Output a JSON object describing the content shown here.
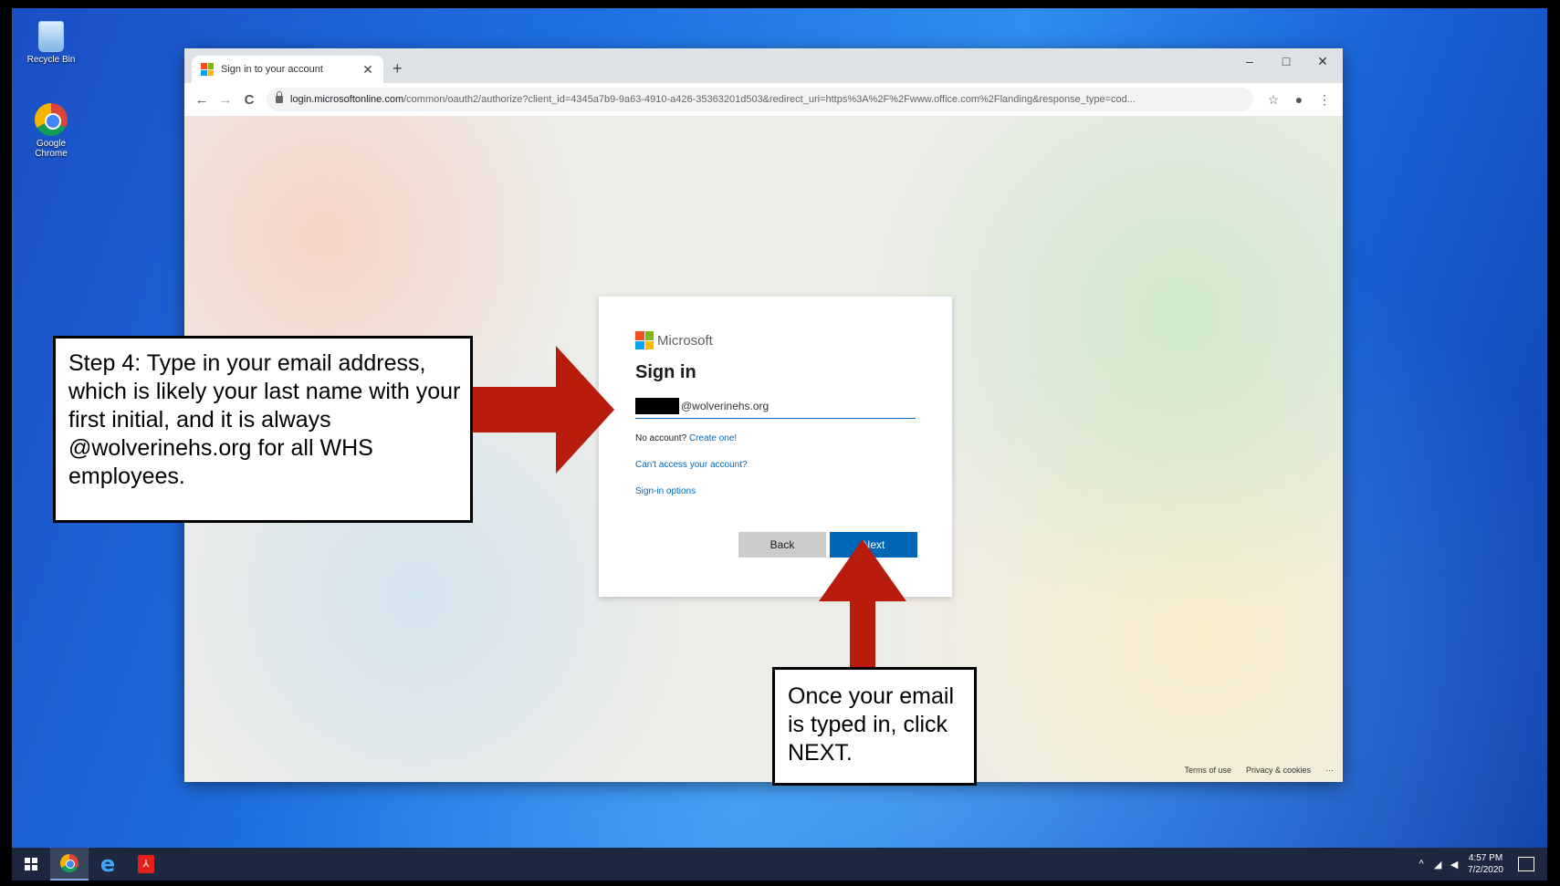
{
  "desktop": {
    "icons": [
      {
        "label": "Recycle Bin"
      },
      {
        "label": "Google Chrome"
      }
    ]
  },
  "browser": {
    "tab_title": "Sign in to your account",
    "new_tab_label": "+",
    "window_controls": {
      "minimize": "–",
      "maximize": "□",
      "close": "✕"
    },
    "nav": {
      "back": "←",
      "forward": "→",
      "reload": "C"
    },
    "url_host": "login.microsoftonline.com",
    "url_rest": "/common/oauth2/authorize?client_id=4345a7b9-9a63-4910-a426-35363201d503&redirect_uri=https%3A%2F%2Fwww.office.com%2Flanding&response_type=cod...",
    "toolbar_icons": {
      "star": "☆",
      "account": "●",
      "menu": "⋮"
    }
  },
  "signin": {
    "brand": "Microsoft",
    "title": "Sign in",
    "email_domain": "@wolverinehs.org",
    "no_account_text": "No account?",
    "create_link": "Create one!",
    "cant_access_link": "Can't access your account?",
    "signin_options_link": "Sign-in options",
    "back_label": "Back",
    "next_label": "Next",
    "footer": {
      "terms": "Terms of use",
      "privacy": "Privacy & cookies",
      "more": "···"
    }
  },
  "annotations": {
    "step4": "Step 4: Type in your email address, which is likely your last name with your first initial, and it is always @wolverinehs.org for all WHS employees.",
    "next_hint": "Once your email is typed in, click NEXT."
  },
  "colors": {
    "arrow": "#b81c0c",
    "ms_red": "#f25022",
    "ms_green": "#7fba00",
    "ms_blue": "#00a4ef",
    "ms_yellow": "#ffb900"
  },
  "taskbar": {
    "time": "4:57 PM",
    "date": "7/2/2020",
    "pdf_label": "⅄"
  }
}
